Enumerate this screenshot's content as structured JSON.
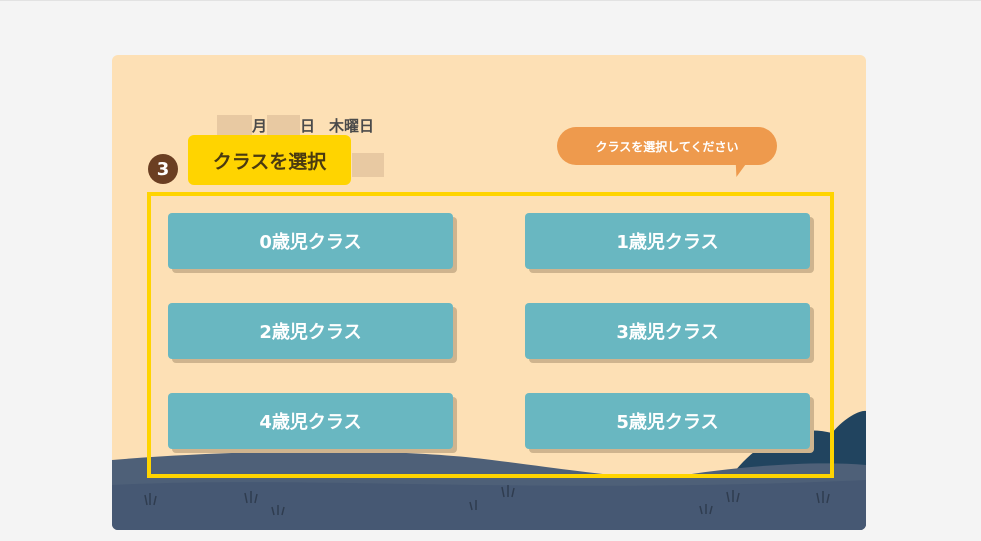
{
  "date": {
    "month_suffix": "月",
    "day_suffix": "日",
    "weekday": "木曜日"
  },
  "speech_bubble": {
    "text": "クラスを選択してください"
  },
  "annotation": {
    "step_number": "3",
    "label": "クラスを選択"
  },
  "classes": [
    {
      "label": "0歳児クラス"
    },
    {
      "label": "1歳児クラス"
    },
    {
      "label": "2歳児クラス"
    },
    {
      "label": "3歳児クラス"
    },
    {
      "label": "4歳児クラス"
    },
    {
      "label": "5歳児クラス"
    }
  ],
  "colors": {
    "background": "#fde0b5",
    "button": "#69b7c1",
    "bubble": "#ee9a4d",
    "highlight": "#ffd400",
    "ground": "#4e6078"
  }
}
